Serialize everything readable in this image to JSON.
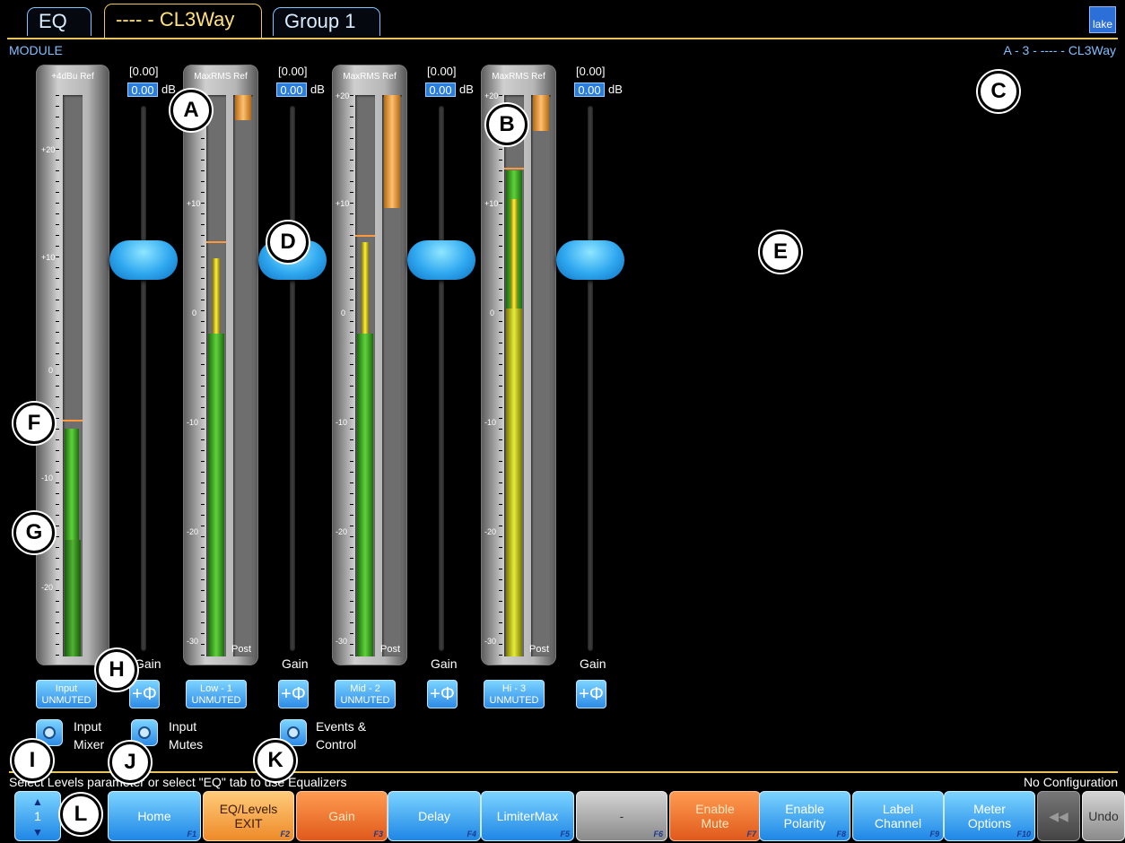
{
  "tabs": [
    {
      "label": "EQ"
    },
    {
      "label": "---- - CL3Way",
      "active": true
    },
    {
      "label": "Group 1"
    }
  ],
  "logo_text": "lake",
  "module_label": "MODULE",
  "module_path": "A - 3 - ---- - CL3Way",
  "meters": [
    {
      "ref": "+4dBu Ref",
      "ticks": [
        "+20",
        "+10",
        "0",
        "-10",
        "-20"
      ]
    },
    {
      "ref": "MaxRMS Ref",
      "ticks": [
        "+20",
        "+10",
        "0",
        "-10",
        "-20",
        "-30"
      ],
      "post": "Post"
    },
    {
      "ref": "MaxRMS Ref",
      "ticks": [
        "+20",
        "+10",
        "0",
        "-10",
        "-20",
        "-30"
      ],
      "post": "Post"
    },
    {
      "ref": "MaxRMS Ref",
      "ticks": [
        "+20",
        "+10",
        "0",
        "-10",
        "-20",
        "-30"
      ],
      "post": "Post"
    }
  ],
  "faders": [
    {
      "readout": "[0.00]",
      "value": "0.00",
      "unit": "dB",
      "label": "Gain"
    },
    {
      "readout": "[0.00]",
      "value": "0.00",
      "unit": "dB",
      "label": "Gain"
    },
    {
      "readout": "[0.00]",
      "value": "0.00",
      "unit": "dB",
      "label": "Gain"
    },
    {
      "readout": "[0.00]",
      "value": "0.00",
      "unit": "dB",
      "label": "Gain"
    }
  ],
  "channel_buttons": [
    {
      "name": "Input",
      "state": "UNMUTED"
    },
    {
      "name": "Low - 1",
      "state": "UNMUTED"
    },
    {
      "name": "Mid - 2",
      "state": "UNMUTED"
    },
    {
      "name": "Hi - 3",
      "state": "UNMUTED"
    }
  ],
  "polarity_symbol": "+Φ",
  "round_buttons": [
    {
      "line1": "Input",
      "line2": "Mixer"
    },
    {
      "line1": "Input",
      "line2": "Mutes"
    },
    {
      "line1": "Events &",
      "line2": "Control"
    }
  ],
  "callouts": [
    "A",
    "B",
    "C",
    "D",
    "E",
    "F",
    "G",
    "H",
    "I",
    "J",
    "K",
    "L"
  ],
  "status_left": "Select Levels parameter or select \"EQ\" tab to use Equalizers",
  "status_right": "No Configuration",
  "page_selector": {
    "value": "1"
  },
  "function_buttons": [
    {
      "line1": "Home",
      "line2": "",
      "key": "F1"
    },
    {
      "line1": "EQ/Levels",
      "line2": "EXIT",
      "key": "F2"
    },
    {
      "line1": "Gain",
      "line2": "",
      "key": "F3"
    },
    {
      "line1": "Delay",
      "line2": "",
      "key": "F4"
    },
    {
      "line1": "LimiterMax",
      "line2": "",
      "key": "F5"
    },
    {
      "line1": "-",
      "line2": "",
      "key": "F6"
    },
    {
      "line1": "Enable",
      "line2": "Mute",
      "key": "F7"
    },
    {
      "line1": "Enable",
      "line2": "Polarity",
      "key": "F8"
    },
    {
      "line1": "Label",
      "line2": "Channel",
      "key": "F9"
    },
    {
      "line1": "Meter",
      "line2": "Options",
      "key": "F10"
    }
  ],
  "rewind_symbol": "◀◀",
  "undo_label": "Undo",
  "colors": {
    "accent_gold": "#e8c55a",
    "accent_blue": "#2d8ae6",
    "meter_green": "#5fd23a",
    "meter_yellow": "#fff23a"
  }
}
